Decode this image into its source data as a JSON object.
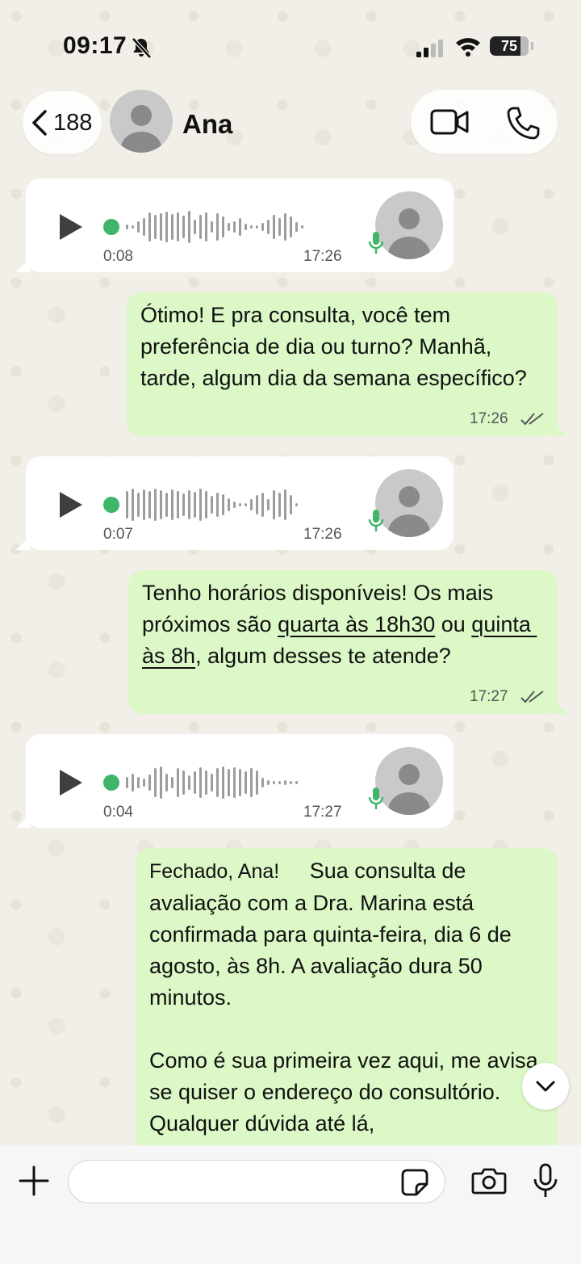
{
  "status_bar": {
    "time": "09:17",
    "battery": "75"
  },
  "header": {
    "back_count": "188",
    "contact_name": "Ana"
  },
  "messages": [
    {
      "type": "voice",
      "duration": "0:08",
      "time": "17:26"
    },
    {
      "type": "text",
      "text": "Ótimo! E pra consulta, você tem preferência de dia ou turno? Manhã, tarde, algum dia da semana específico?",
      "time": "17:26"
    },
    {
      "type": "voice",
      "duration": "0:07",
      "time": "17:26"
    },
    {
      "type": "text",
      "text_before": "Tenho horários disponíveis! Os mais próximos são ",
      "link1": "quarta às 18h30",
      "text_mid": " ou ",
      "link2": "quinta às 8h",
      "text_after": ", algum desses te atende?",
      "time": "17:27"
    },
    {
      "type": "voice",
      "duration": "0:04",
      "time": "17:27"
    },
    {
      "type": "text",
      "greeting": "Fechado, Ana!",
      "text": "Sua consulta de avaliação com a Dra. Marina está confirmada para quinta-feira, dia 6 de agosto, às 8h. A avaliação dura 50 minutos.",
      "text2": "Como é sua primeira vez aqui, me avisa se quiser o endereço do consultório. Qualquer dúvida até lá,"
    }
  ],
  "composer": {
    "placeholder": ""
  },
  "icons": [
    "bell-slash-icon",
    "signal-icon",
    "wifi-icon",
    "chevron-left-icon",
    "video-icon",
    "phone-icon",
    "play-icon",
    "mic-icon",
    "double-check-icon",
    "chevron-down-icon",
    "plus-icon",
    "sticker-icon",
    "camera-icon"
  ],
  "colors": {
    "incoming": "#ffffff",
    "outgoing": "#dbf8c6",
    "voice_dot": "#3fb56a",
    "background": "#f1efe8"
  }
}
